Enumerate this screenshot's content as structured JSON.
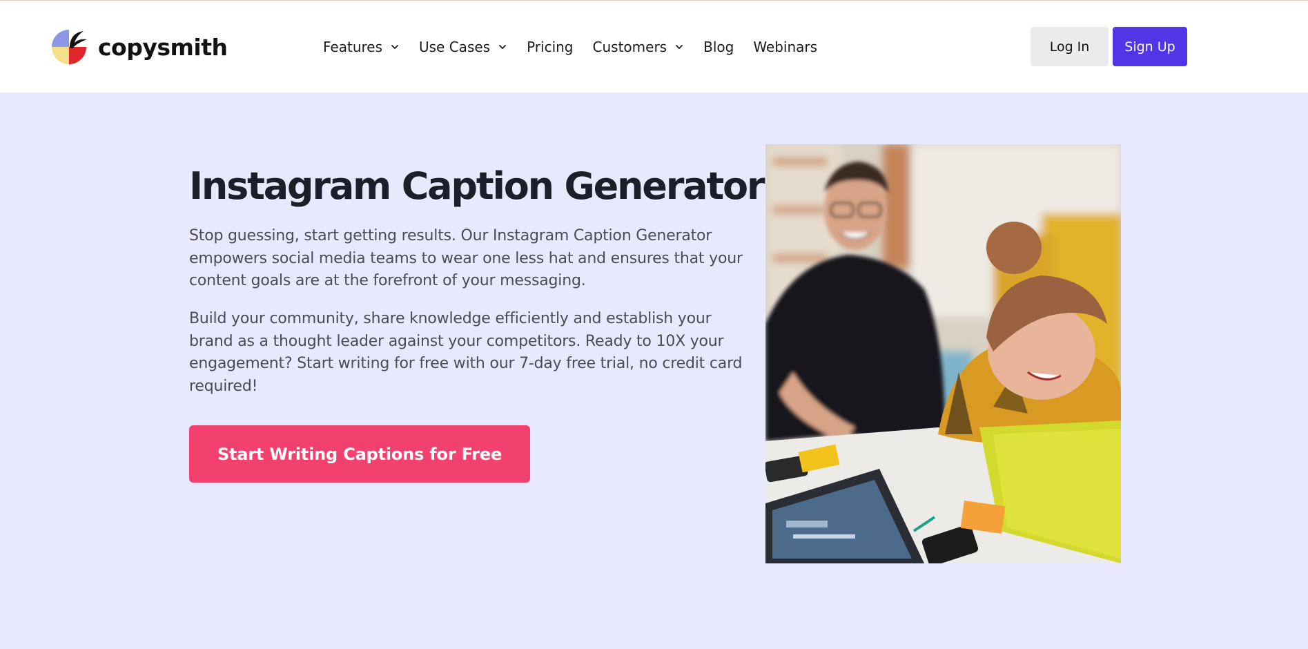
{
  "brand": {
    "name": "copysmith",
    "colors": {
      "primary": "#5135e6",
      "cta": "#f2416e",
      "hero_bg": "#e8e9fc",
      "logo_blue": "#8e97e3",
      "logo_yellow": "#f5e08a",
      "logo_red": "#e0262b",
      "logo_black": "#121212"
    }
  },
  "nav": {
    "items": [
      {
        "label": "Features",
        "has_dropdown": true,
        "icon": "chevron-down-icon"
      },
      {
        "label": "Use Cases",
        "has_dropdown": true,
        "icon": "chevron-down-icon"
      },
      {
        "label": "Pricing",
        "has_dropdown": false
      },
      {
        "label": "Customers",
        "has_dropdown": true,
        "icon": "chevron-down-icon"
      },
      {
        "label": "Blog",
        "has_dropdown": false
      },
      {
        "label": "Webinars",
        "has_dropdown": false
      }
    ],
    "login_label": "Log In",
    "signup_label": "Sign Up"
  },
  "hero": {
    "title": "Instagram Caption Generator",
    "paragraph1": "Stop guessing, start getting results. Our Instagram Caption Generator empowers social media teams to wear one less hat and ensures that your content goals are at the forefront of your messaging.",
    "paragraph2": "Build your community, share knowledge efficiently and establish your brand as a thought leader against your competitors. Ready to 10X your engagement? Start writing for free with our 7-day free trial, no credit card required!",
    "cta_label": "Start Writing Captions for Free",
    "image_icon": "hero-photo"
  }
}
